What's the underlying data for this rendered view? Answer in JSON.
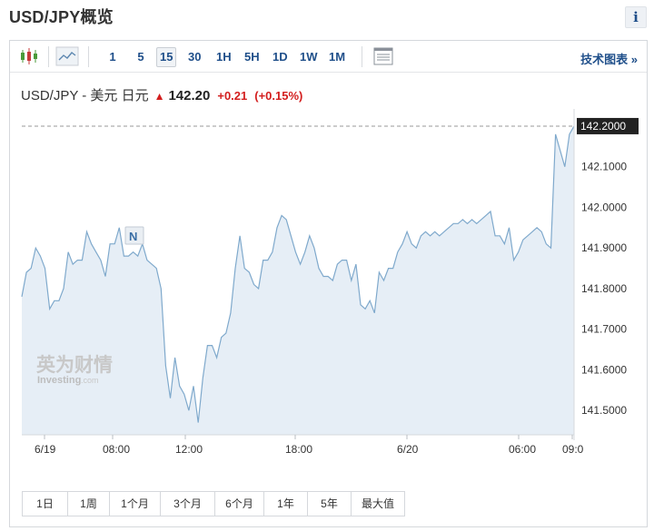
{
  "header": {
    "title": "USD/JPY概览",
    "info_label": "i"
  },
  "toolbar": {
    "icons": [
      "candlestick-icon",
      "area-chart-icon",
      "settings-window-icon"
    ],
    "timeframes": [
      "1",
      "5",
      "15",
      "30",
      "1H",
      "5H",
      "1D",
      "1W",
      "1M"
    ],
    "active_timeframe": "15",
    "technical_link": "技术图表 »"
  },
  "quote": {
    "pair": "USD/JPY - 美元 日元",
    "price": "142.20",
    "change": "+0.21",
    "change_pct": "(+0.15%)",
    "direction": "up"
  },
  "marker": {
    "label": "N"
  },
  "watermark": {
    "brand_cn": "英为财情",
    "brand_en": "Investing",
    "brand_suffix": ".com"
  },
  "range_buttons": [
    "1日",
    "1周",
    "1个月",
    "3个月",
    "6个月",
    "1年",
    "5年",
    "最大值"
  ],
  "colors": {
    "line": "#7fa9cc",
    "fill": "#e6eef6",
    "link": "#1f4f8a",
    "up": "#d31e1e",
    "current_price_bg": "#222222"
  },
  "chart_data": {
    "type": "area",
    "title": "USD/JPY - 美元 日元",
    "x_tick_labels": [
      "6/19",
      "08:00",
      "12:00",
      "18:00",
      "6/20",
      "06:00",
      "09:0"
    ],
    "y_tick_labels": [
      "142.1000",
      "142.0000",
      "141.9000",
      "141.8000",
      "141.7000",
      "141.6000",
      "141.5000"
    ],
    "ylim": [
      141.44,
      142.22
    ],
    "current_value": 142.2,
    "current_value_label": "142.2000",
    "grid": false,
    "series": [
      {
        "values": [
          141.78,
          141.84,
          141.85,
          141.9,
          141.88,
          141.85,
          141.75,
          141.77,
          141.77,
          141.8,
          141.89,
          141.86,
          141.87,
          141.87,
          141.94,
          141.91,
          141.89,
          141.87,
          141.83,
          141.91,
          141.91,
          141.95,
          141.88,
          141.88,
          141.89,
          141.88,
          141.91,
          141.87,
          141.86,
          141.85,
          141.8,
          141.61,
          141.53,
          141.63,
          141.56,
          141.54,
          141.5,
          141.56,
          141.47,
          141.58,
          141.66,
          141.66,
          141.63,
          141.68,
          141.69,
          141.74,
          141.85,
          141.93,
          141.85,
          141.84,
          141.81,
          141.8,
          141.87,
          141.87,
          141.89,
          141.95,
          141.98,
          141.97,
          141.93,
          141.89,
          141.86,
          141.89,
          141.93,
          141.9,
          141.85,
          141.83,
          141.83,
          141.82,
          141.86,
          141.87,
          141.87,
          141.82,
          141.86,
          141.76,
          141.75,
          141.77,
          141.74,
          141.84,
          141.82,
          141.85,
          141.85,
          141.89,
          141.91,
          141.94,
          141.91,
          141.9,
          141.93,
          141.94,
          141.93,
          141.94,
          141.93,
          141.94,
          141.95,
          141.96,
          141.96,
          141.97,
          141.96,
          141.97,
          141.96,
          141.97,
          141.98,
          141.99,
          141.93,
          141.93,
          141.91,
          141.95,
          141.87,
          141.89,
          141.92,
          141.93,
          141.94,
          141.95,
          141.94,
          141.91,
          141.9,
          142.18,
          142.14,
          142.1,
          142.18,
          142.2
        ]
      }
    ]
  }
}
